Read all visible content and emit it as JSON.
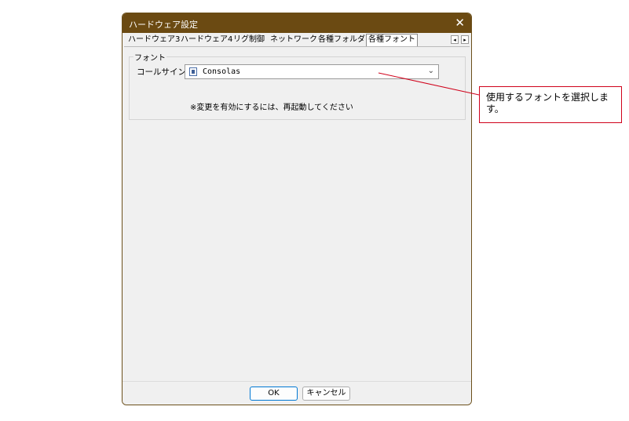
{
  "window": {
    "title": "ハードウェア設定",
    "close_glyph": "✕"
  },
  "tabs": [
    {
      "label": "ハードウェア3",
      "active": false
    },
    {
      "label": "ハードウェア4",
      "active": false
    },
    {
      "label": "リグ制御",
      "active": false
    },
    {
      "label": "ネットワーク",
      "active": false
    },
    {
      "label": "各種フォルダ",
      "active": false
    },
    {
      "label": "各種フォント",
      "active": true
    }
  ],
  "tab_scroll": {
    "left_glyph": "◂",
    "right_glyph": "▸"
  },
  "font_group": {
    "legend": "フォント",
    "callsign_label": "コールサイン",
    "callsign_font": {
      "value": "Consolas",
      "icon": "truetype-font-icon",
      "chevron": "⌄"
    },
    "restart_note": "※変更を有効にするには、再起動してください"
  },
  "buttons": {
    "ok": "OK",
    "cancel": "キャンセル"
  },
  "callout": {
    "text": "使用するフォントを選択します。",
    "border_color": "#d0021b"
  },
  "colors": {
    "titlebar": "#6b4a12",
    "dialog_bg": "#f0f0f0",
    "ok_border": "#0078d4"
  }
}
